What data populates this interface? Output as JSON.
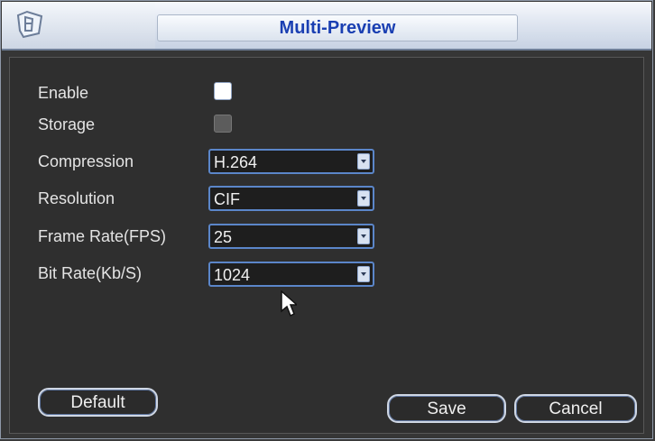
{
  "window": {
    "title": "Multi-Preview"
  },
  "form": {
    "enable_label": "Enable",
    "storage_label": "Storage",
    "compression_label": "Compression",
    "compression_value": "H.264",
    "resolution_label": "Resolution",
    "resolution_value": "CIF",
    "frame_rate_label": "Frame Rate(FPS)",
    "frame_rate_value": "25",
    "bit_rate_label": "Bit Rate(Kb/S)",
    "bit_rate_value": "1024",
    "enable_checked": false,
    "storage_disabled": true
  },
  "buttons": {
    "default_label": "Default",
    "save_label": "Save",
    "cancel_label": "Cancel"
  },
  "colors": {
    "title_text": "#1a3fb2",
    "dropdown_border": "#5b86c9",
    "button_border": "#cfd7e4"
  },
  "icons": {
    "title_logo": "app-logo-icon",
    "dropdown_arrow": "chevron-down-icon",
    "pointer": "cursor-arrow-icon"
  }
}
